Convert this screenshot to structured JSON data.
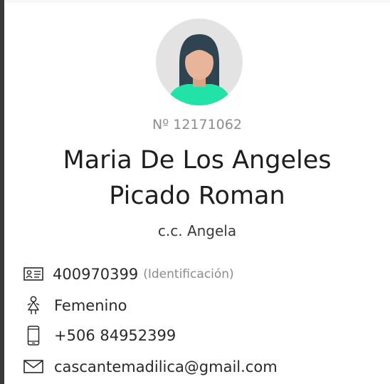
{
  "profile": {
    "number": "Nº 12171062",
    "name_line1": "Maria De Los Angeles",
    "name_line2": "Picado Roman",
    "alias": "c.c. Angela"
  },
  "details": {
    "id": {
      "icon": "id-card-icon",
      "value": "400970399",
      "label": "(Identificación)"
    },
    "gender": {
      "icon": "female-icon",
      "value": "Femenino"
    },
    "phone": {
      "icon": "phone-icon",
      "value": "+506 84952399"
    },
    "email": {
      "icon": "mail-icon",
      "value": "cascantemadilica@gmail.com"
    }
  },
  "colors": {
    "avatar_bg": "#e3e3e3",
    "avatar_shirt": "#21e3a8",
    "avatar_hair": "#2f4350",
    "avatar_skin": "#e8b49a"
  }
}
